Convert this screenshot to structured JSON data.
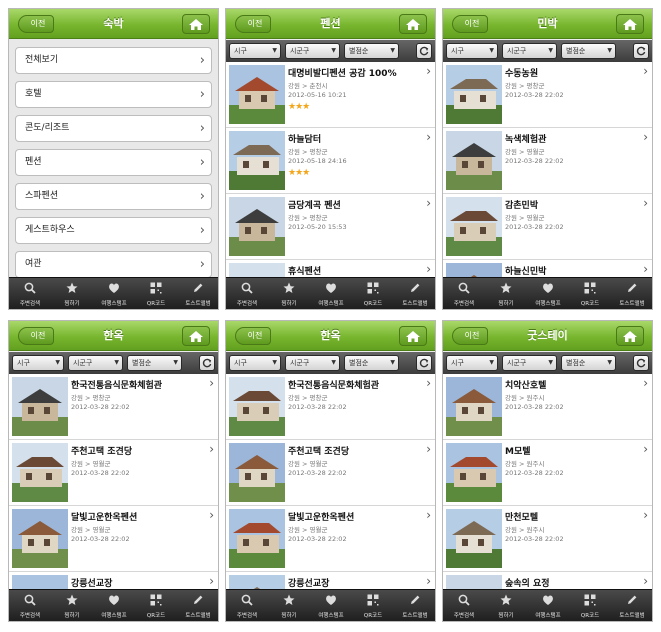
{
  "common": {
    "back_label": "이전",
    "filters": {
      "region": "시구",
      "district": "시군구",
      "sort": "별점순"
    },
    "tabs": [
      "주변검색",
      "찜하기",
      "여행스탬프",
      "QR코드",
      "토스트앨범"
    ]
  },
  "screens": [
    {
      "title": "숙박",
      "categories": [
        "전체보기",
        "호텔",
        "콘도/리조트",
        "펜션",
        "스파펜션",
        "게스트하우스",
        "여관"
      ]
    },
    {
      "title": "펜션",
      "items": [
        {
          "name": "대명비발디펜션 공감 100%",
          "location": "강원 > 춘천시",
          "date": "2012-05-16 10:21",
          "stars": "★★★"
        },
        {
          "name": "하늘담터",
          "location": "강원 > 평창군",
          "date": "2012-05-18 24:16",
          "stars": "★★★"
        },
        {
          "name": "금당계곡 펜션",
          "location": "강원 > 평창군",
          "date": "2012-05-20 15:53",
          "stars": ""
        },
        {
          "name": "휴식펜션",
          "location": "",
          "date": "",
          "stars": ""
        }
      ]
    },
    {
      "title": "민박",
      "items": [
        {
          "name": "수동농원",
          "location": "강원 > 평창군",
          "date": "2012-03-28 22:02",
          "stars": ""
        },
        {
          "name": "녹색체험관",
          "location": "강원 > 영월군",
          "date": "2012-03-28 22:02",
          "stars": ""
        },
        {
          "name": "감촌민박",
          "location": "강원 > 영월군",
          "date": "2012-03-28 22:02",
          "stars": ""
        },
        {
          "name": "하늘신민박",
          "location": "",
          "date": "",
          "stars": ""
        }
      ]
    },
    {
      "title": "한옥",
      "items": [
        {
          "name": "한국전통음식문화체험관",
          "location": "강원 > 평창군",
          "date": "2012-03-28 22:02",
          "stars": ""
        },
        {
          "name": "주천고택 조견당",
          "location": "강원 > 영월군",
          "date": "2012-03-28 22:02",
          "stars": ""
        },
        {
          "name": "달빛고운한옥펜션",
          "location": "강원 > 영월군",
          "date": "2012-03-28 22:02",
          "stars": ""
        },
        {
          "name": "강릉선교장",
          "location": "",
          "date": "",
          "stars": ""
        }
      ]
    },
    {
      "title": "한옥",
      "items": [
        {
          "name": "한국전통음식문화체험관",
          "location": "강원 > 평창군",
          "date": "2012-03-28 22:02",
          "stars": ""
        },
        {
          "name": "주천고택 조견당",
          "location": "강원 > 영월군",
          "date": "2012-03-28 22:02",
          "stars": ""
        },
        {
          "name": "달빛고운한옥펜션",
          "location": "강원 > 영월군",
          "date": "2012-03-28 22:02",
          "stars": ""
        },
        {
          "name": "강릉선교장",
          "location": "",
          "date": "",
          "stars": ""
        }
      ]
    },
    {
      "title": "굿스테이",
      "items": [
        {
          "name": "치악산호텔",
          "location": "강원 > 원주시",
          "date": "2012-03-28 22:02",
          "stars": ""
        },
        {
          "name": "M모텔",
          "location": "강원 > 원주시",
          "date": "2012-03-28 22:02",
          "stars": ""
        },
        {
          "name": "만천모텔",
          "location": "강원 > 원주시",
          "date": "2012-03-28 22:02",
          "stars": ""
        },
        {
          "name": "숲속의 요정",
          "location": "",
          "date": "",
          "stars": ""
        }
      ]
    }
  ],
  "colors": {
    "header_green": "#78b62f",
    "tabbar_dark": "#2a2a2a",
    "star_orange": "#f3a61c"
  }
}
